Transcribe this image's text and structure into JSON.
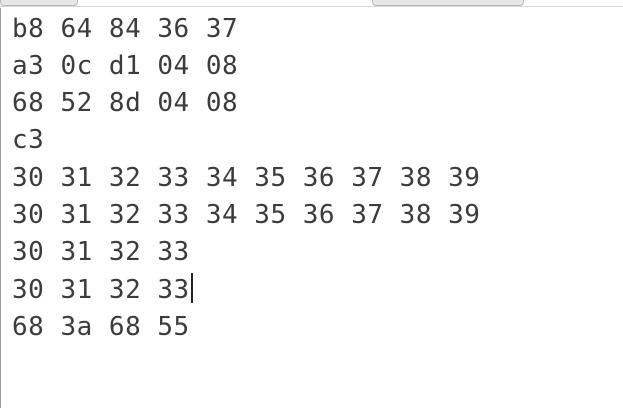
{
  "editor": {
    "lines": [
      "b8 64 84 36 37",
      "a3 0c d1 04 08",
      "68 52 8d 04 08",
      "c3",
      "30 31 32 33 34 35 36 37 38 39",
      "30 31 32 33 34 35 36 37 38 39",
      "30 31 32 33",
      "30 31 32 33",
      "68 3a 68 55"
    ],
    "caret_line_index": 7
  }
}
